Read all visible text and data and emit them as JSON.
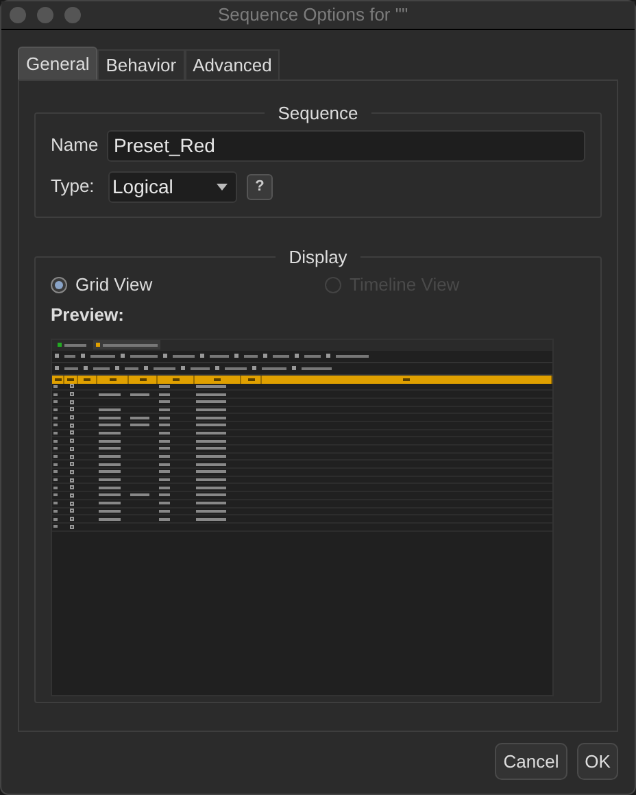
{
  "window": {
    "title": "Sequence Options for \"\""
  },
  "tabs": [
    {
      "label": "General",
      "selected": true
    },
    {
      "label": "Behavior",
      "selected": false
    },
    {
      "label": "Advanced",
      "selected": false
    }
  ],
  "sequence_group": {
    "title": "Sequence",
    "name_label": "Name",
    "name_value": "Preset_Red",
    "type_label": "Type:",
    "type_value": "Logical",
    "help_button": "?"
  },
  "display_group": {
    "title": "Display",
    "options": [
      {
        "label": "Grid View",
        "selected": true,
        "disabled": false
      },
      {
        "label": "Timeline View",
        "selected": false,
        "disabled": true
      }
    ],
    "preview_label": "Preview:"
  },
  "buttons": [
    "Cancel",
    "OK"
  ]
}
